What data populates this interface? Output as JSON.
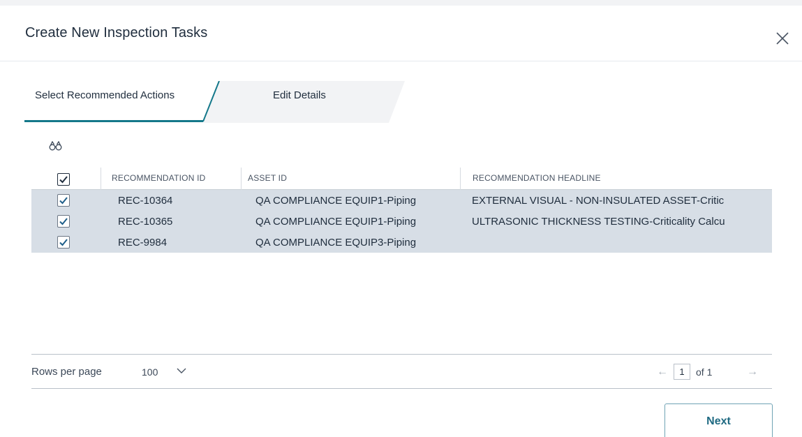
{
  "dialog": {
    "title": "Create New Inspection Tasks"
  },
  "wizard": {
    "steps": [
      {
        "label": "Select Recommended Actions",
        "active": true
      },
      {
        "label": "Edit Details",
        "active": false
      }
    ],
    "accent_color": "#14788a"
  },
  "toolbar": {
    "search_icon": "binoculars-icon"
  },
  "grid": {
    "columns": [
      "RECOMMENDATION ID",
      "ASSET ID",
      "RECOMMENDATION HEADLINE"
    ],
    "select_all_checked": true,
    "rows": [
      {
        "checked": true,
        "recommendation_id": "REC-10364",
        "asset_id": "QA COMPLIANCE EQUIP1-Piping",
        "headline": "EXTERNAL VISUAL - NON-INSULATED ASSET-Critic"
      },
      {
        "checked": true,
        "recommendation_id": "REC-10365",
        "asset_id": "QA COMPLIANCE EQUIP1-Piping",
        "headline": "ULTRASONIC THICKNESS TESTING-Criticality Calcu"
      },
      {
        "checked": true,
        "recommendation_id": "REC-9984",
        "asset_id": "QA COMPLIANCE EQUIP3-Piping",
        "headline": ""
      }
    ],
    "row_color": "#d7dee6"
  },
  "pager": {
    "rows_per_page_label": "Rows per page",
    "rows_per_page_value": "100",
    "current_page": "1",
    "of_label": "of 1"
  },
  "footer": {
    "next_label": "Next"
  }
}
